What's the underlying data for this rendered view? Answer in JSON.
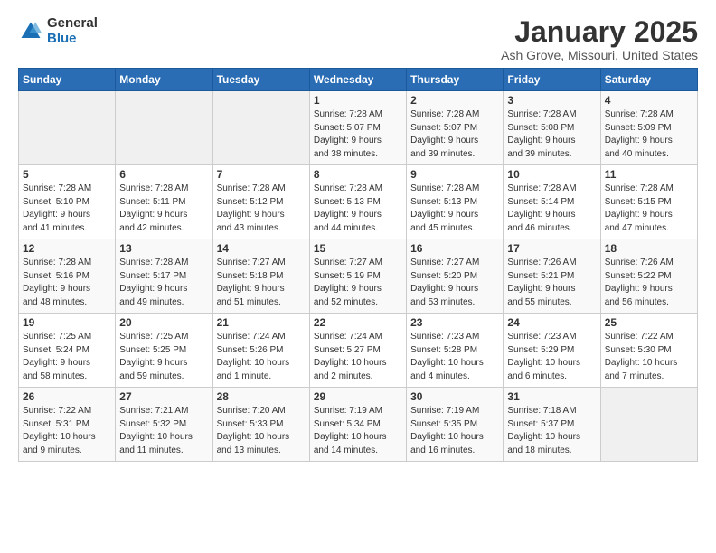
{
  "logo": {
    "general": "General",
    "blue": "Blue"
  },
  "title": "January 2025",
  "location": "Ash Grove, Missouri, United States",
  "days_of_week": [
    "Sunday",
    "Monday",
    "Tuesday",
    "Wednesday",
    "Thursday",
    "Friday",
    "Saturday"
  ],
  "weeks": [
    [
      {
        "num": "",
        "info": ""
      },
      {
        "num": "",
        "info": ""
      },
      {
        "num": "",
        "info": ""
      },
      {
        "num": "1",
        "info": "Sunrise: 7:28 AM\nSunset: 5:07 PM\nDaylight: 9 hours\nand 38 minutes."
      },
      {
        "num": "2",
        "info": "Sunrise: 7:28 AM\nSunset: 5:07 PM\nDaylight: 9 hours\nand 39 minutes."
      },
      {
        "num": "3",
        "info": "Sunrise: 7:28 AM\nSunset: 5:08 PM\nDaylight: 9 hours\nand 39 minutes."
      },
      {
        "num": "4",
        "info": "Sunrise: 7:28 AM\nSunset: 5:09 PM\nDaylight: 9 hours\nand 40 minutes."
      }
    ],
    [
      {
        "num": "5",
        "info": "Sunrise: 7:28 AM\nSunset: 5:10 PM\nDaylight: 9 hours\nand 41 minutes."
      },
      {
        "num": "6",
        "info": "Sunrise: 7:28 AM\nSunset: 5:11 PM\nDaylight: 9 hours\nand 42 minutes."
      },
      {
        "num": "7",
        "info": "Sunrise: 7:28 AM\nSunset: 5:12 PM\nDaylight: 9 hours\nand 43 minutes."
      },
      {
        "num": "8",
        "info": "Sunrise: 7:28 AM\nSunset: 5:13 PM\nDaylight: 9 hours\nand 44 minutes."
      },
      {
        "num": "9",
        "info": "Sunrise: 7:28 AM\nSunset: 5:13 PM\nDaylight: 9 hours\nand 45 minutes."
      },
      {
        "num": "10",
        "info": "Sunrise: 7:28 AM\nSunset: 5:14 PM\nDaylight: 9 hours\nand 46 minutes."
      },
      {
        "num": "11",
        "info": "Sunrise: 7:28 AM\nSunset: 5:15 PM\nDaylight: 9 hours\nand 47 minutes."
      }
    ],
    [
      {
        "num": "12",
        "info": "Sunrise: 7:28 AM\nSunset: 5:16 PM\nDaylight: 9 hours\nand 48 minutes."
      },
      {
        "num": "13",
        "info": "Sunrise: 7:28 AM\nSunset: 5:17 PM\nDaylight: 9 hours\nand 49 minutes."
      },
      {
        "num": "14",
        "info": "Sunrise: 7:27 AM\nSunset: 5:18 PM\nDaylight: 9 hours\nand 51 minutes."
      },
      {
        "num": "15",
        "info": "Sunrise: 7:27 AM\nSunset: 5:19 PM\nDaylight: 9 hours\nand 52 minutes."
      },
      {
        "num": "16",
        "info": "Sunrise: 7:27 AM\nSunset: 5:20 PM\nDaylight: 9 hours\nand 53 minutes."
      },
      {
        "num": "17",
        "info": "Sunrise: 7:26 AM\nSunset: 5:21 PM\nDaylight: 9 hours\nand 55 minutes."
      },
      {
        "num": "18",
        "info": "Sunrise: 7:26 AM\nSunset: 5:22 PM\nDaylight: 9 hours\nand 56 minutes."
      }
    ],
    [
      {
        "num": "19",
        "info": "Sunrise: 7:25 AM\nSunset: 5:24 PM\nDaylight: 9 hours\nand 58 minutes."
      },
      {
        "num": "20",
        "info": "Sunrise: 7:25 AM\nSunset: 5:25 PM\nDaylight: 9 hours\nand 59 minutes."
      },
      {
        "num": "21",
        "info": "Sunrise: 7:24 AM\nSunset: 5:26 PM\nDaylight: 10 hours\nand 1 minute."
      },
      {
        "num": "22",
        "info": "Sunrise: 7:24 AM\nSunset: 5:27 PM\nDaylight: 10 hours\nand 2 minutes."
      },
      {
        "num": "23",
        "info": "Sunrise: 7:23 AM\nSunset: 5:28 PM\nDaylight: 10 hours\nand 4 minutes."
      },
      {
        "num": "24",
        "info": "Sunrise: 7:23 AM\nSunset: 5:29 PM\nDaylight: 10 hours\nand 6 minutes."
      },
      {
        "num": "25",
        "info": "Sunrise: 7:22 AM\nSunset: 5:30 PM\nDaylight: 10 hours\nand 7 minutes."
      }
    ],
    [
      {
        "num": "26",
        "info": "Sunrise: 7:22 AM\nSunset: 5:31 PM\nDaylight: 10 hours\nand 9 minutes."
      },
      {
        "num": "27",
        "info": "Sunrise: 7:21 AM\nSunset: 5:32 PM\nDaylight: 10 hours\nand 11 minutes."
      },
      {
        "num": "28",
        "info": "Sunrise: 7:20 AM\nSunset: 5:33 PM\nDaylight: 10 hours\nand 13 minutes."
      },
      {
        "num": "29",
        "info": "Sunrise: 7:19 AM\nSunset: 5:34 PM\nDaylight: 10 hours\nand 14 minutes."
      },
      {
        "num": "30",
        "info": "Sunrise: 7:19 AM\nSunset: 5:35 PM\nDaylight: 10 hours\nand 16 minutes."
      },
      {
        "num": "31",
        "info": "Sunrise: 7:18 AM\nSunset: 5:37 PM\nDaylight: 10 hours\nand 18 minutes."
      },
      {
        "num": "",
        "info": ""
      }
    ]
  ]
}
